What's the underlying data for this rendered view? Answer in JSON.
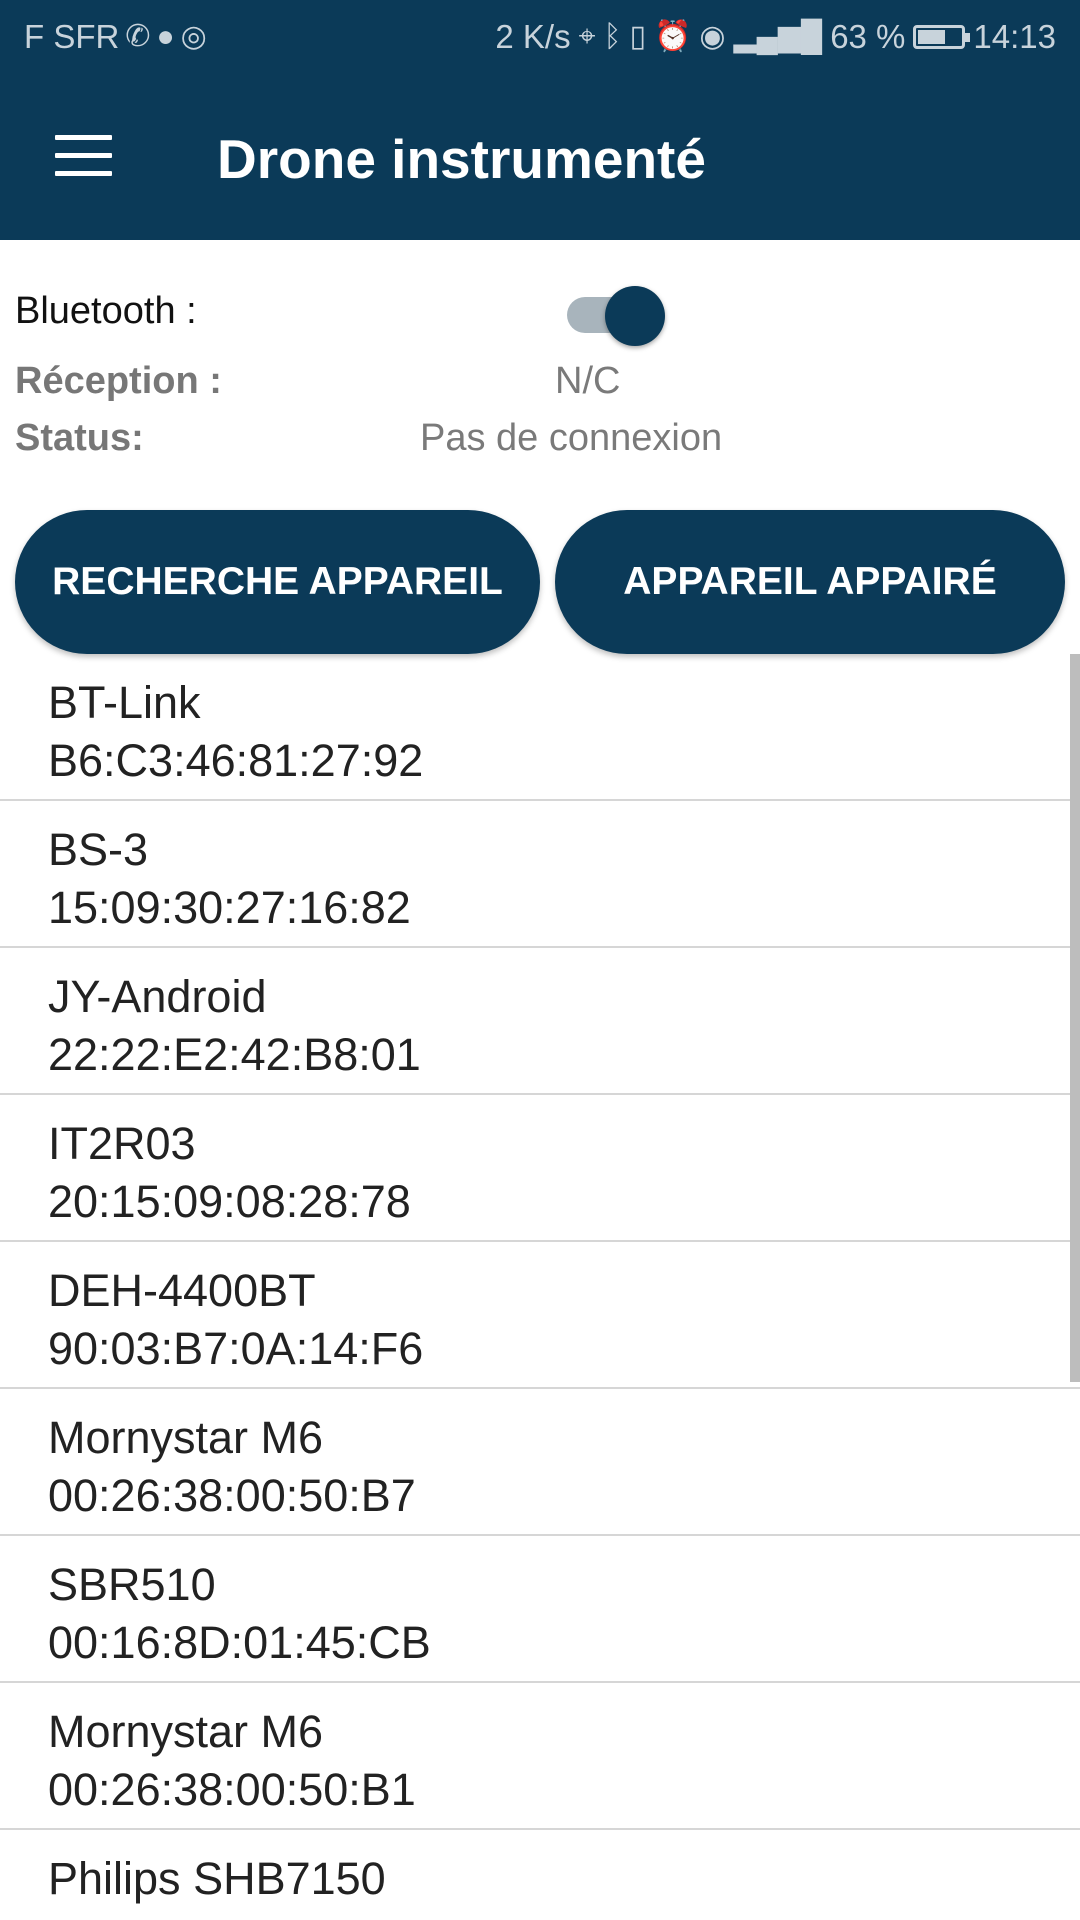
{
  "status_bar": {
    "carrier": "F SFR",
    "speed": "2 K/s",
    "battery": "63 %",
    "battery_level": 0.63,
    "time": "14:13",
    "icons_left": [
      "whatsapp-icon",
      "chat-bubble-icon",
      "instagram-icon"
    ],
    "icons_right": [
      "location-icon",
      "bluetooth-icon",
      "vibrate-icon",
      "alarm-icon",
      "eye-icon",
      "signal-4g-icon",
      "battery-icon"
    ]
  },
  "app_bar": {
    "title": "Drone instrumenté"
  },
  "info": {
    "bluetooth_label": "Bluetooth :",
    "bluetooth_on": true,
    "reception_label": "Réception :",
    "reception_value": "N/C",
    "status_label": "Status:",
    "status_value": "Pas de connexion"
  },
  "buttons": {
    "search": "RECHERCHE APPAREIL",
    "paired": "APPAREIL APPAIRÉ"
  },
  "devices": [
    {
      "name": "BT-Link",
      "address": "B6:C3:46:81:27:92"
    },
    {
      "name": "BS-3",
      "address": "15:09:30:27:16:82"
    },
    {
      "name": "JY-Android",
      "address": "22:22:E2:42:B8:01"
    },
    {
      "name": "IT2R03",
      "address": "20:15:09:08:28:78"
    },
    {
      "name": "DEH-4400BT",
      "address": "90:03:B7:0A:14:F6"
    },
    {
      "name": "Mornystar M6",
      "address": "00:26:38:00:50:B7"
    },
    {
      "name": "SBR510",
      "address": "00:16:8D:01:45:CB"
    },
    {
      "name": "Mornystar M6",
      "address": "00:26:38:00:50:B1"
    },
    {
      "name": "Philips SHB7150",
      "address": ""
    }
  ],
  "colors": {
    "primary": "#0b3a58",
    "switch_track": "#a8b4bc",
    "divider": "#d6d6d6",
    "secondary_text": "#7a7a7a"
  }
}
